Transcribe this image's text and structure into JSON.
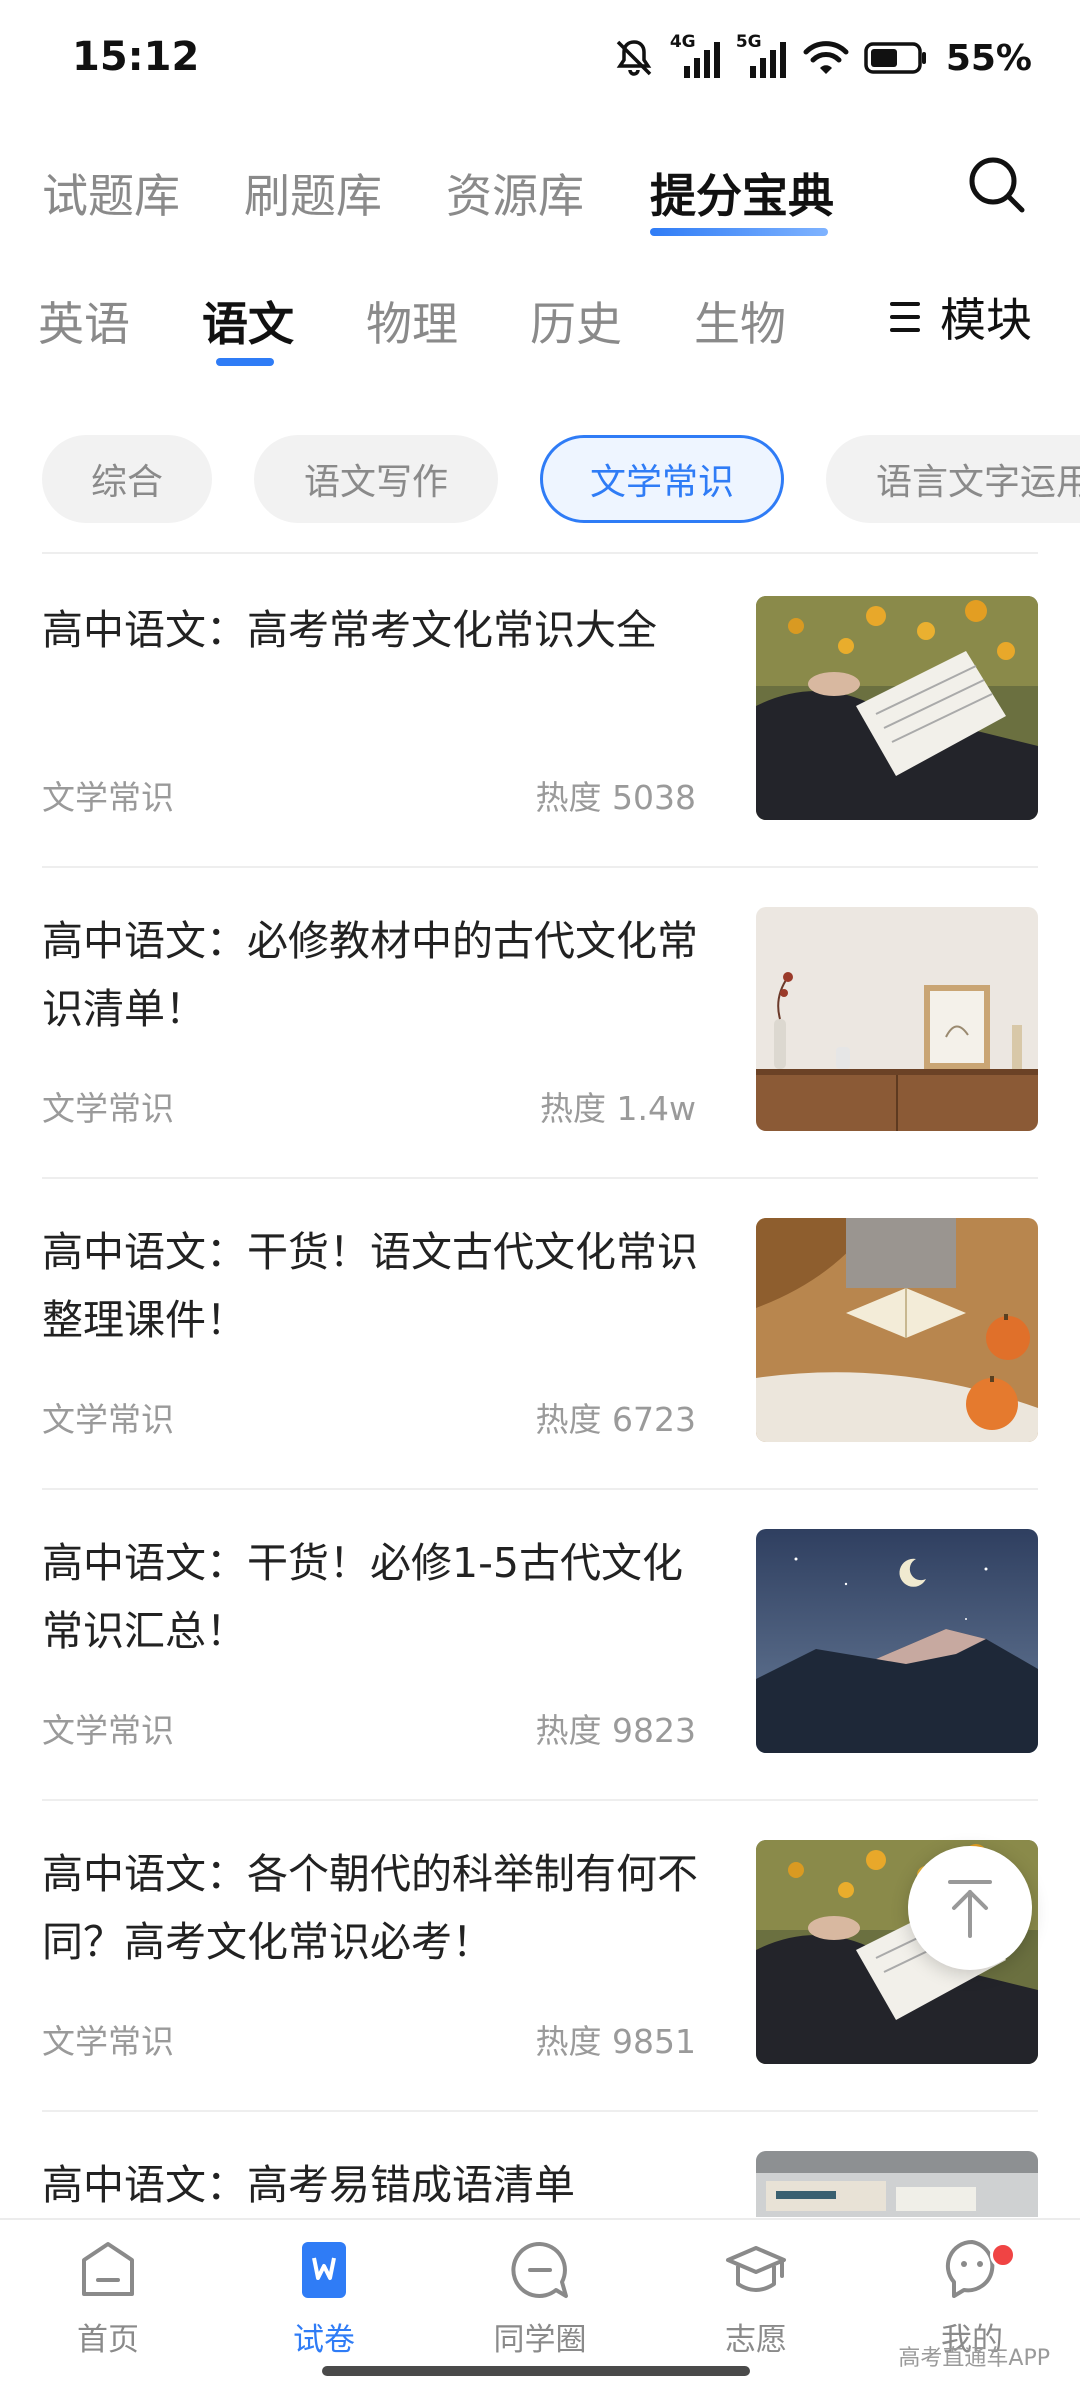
{
  "status_bar": {
    "time": "15:12",
    "net_4g": "4G",
    "net_5g": "5G",
    "battery": "55%"
  },
  "top_tabs": [
    {
      "label": "试题库"
    },
    {
      "label": "刷题库"
    },
    {
      "label": "资源库"
    },
    {
      "label": "提分宝典",
      "active": true
    }
  ],
  "subject_tabs": [
    {
      "label": "英语"
    },
    {
      "label": "语文",
      "active": true
    },
    {
      "label": "物理"
    },
    {
      "label": "历史"
    },
    {
      "label": "生物"
    }
  ],
  "module_button": {
    "label": "模块",
    "icon": "list-icon"
  },
  "chips": [
    {
      "label": "综合"
    },
    {
      "label": "语文写作"
    },
    {
      "label": "文学常识",
      "active": true
    },
    {
      "label": "语言文字运用"
    }
  ],
  "articles": [
    {
      "title": "高中语文：高考常考文化常识大全",
      "category": "文学常识",
      "hot": "热度 5038",
      "thumb": "reading-book-flowers"
    },
    {
      "title": "高中语文：必修教材中的古代文化常识清单！",
      "category": "文学常识",
      "hot": "热度 1.4w",
      "thumb": "sideboard-frame"
    },
    {
      "title": "高中语文：干货！语文古代文化常识整理课件！",
      "category": "文学常识",
      "hot": "热度 6723",
      "thumb": "book-pumpkins"
    },
    {
      "title": "高中语文：干货！必修1-5古代文化常识汇总！",
      "category": "文学常识",
      "hot": "热度 9823",
      "thumb": "moon-mountain"
    },
    {
      "title": "高中语文：各个朝代的科举制有何不同？高考文化常识必考！",
      "category": "文学常识",
      "hot": "热度 9851",
      "thumb": "reading-book-flowers"
    },
    {
      "title": "高中语文：高考易错成语清单",
      "category": "",
      "hot": "",
      "thumb": "desk-papers"
    }
  ],
  "bottom_nav": [
    {
      "label": "首页",
      "icon": "home-icon"
    },
    {
      "label": "试卷",
      "icon": "paper-icon",
      "active": true
    },
    {
      "label": "同学圈",
      "icon": "chat-icon"
    },
    {
      "label": "志愿",
      "icon": "graduation-cap-icon"
    },
    {
      "label": "我的",
      "icon": "profile-icon",
      "badge": true
    }
  ],
  "watermark": "高考直通车APP",
  "colors": {
    "accent": "#2f7cf6",
    "text": "#222222",
    "muted": "#8a8a8a",
    "badge": "#f04444"
  }
}
